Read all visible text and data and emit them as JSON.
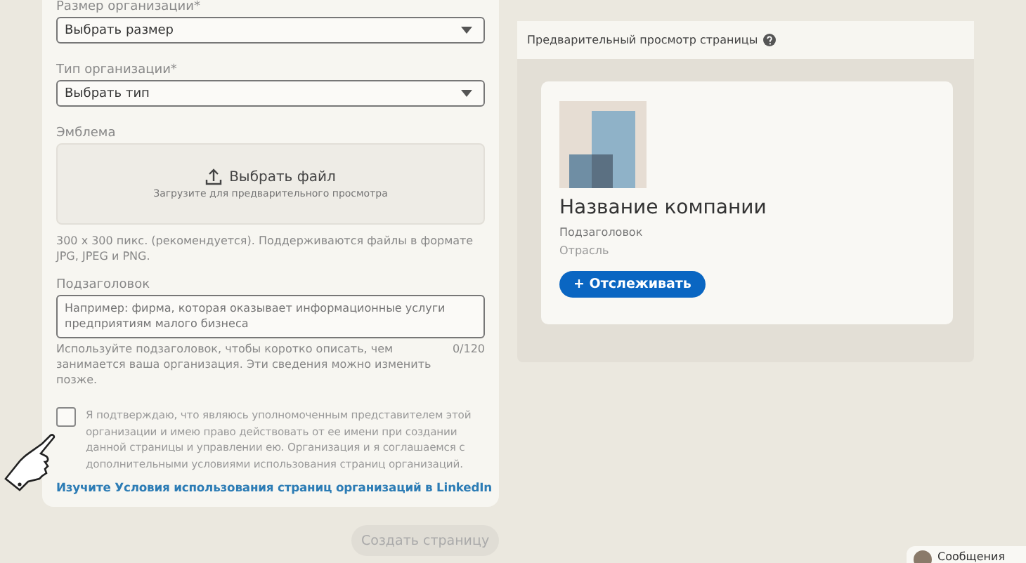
{
  "form": {
    "size_field": {
      "label": "Размер организации*",
      "value": "Выбрать размер"
    },
    "type_field": {
      "label": "Тип организации*",
      "value": "Выбрать тип"
    },
    "logo": {
      "label": "Эмблема",
      "button": "Выбрать файл",
      "caption": "Загрузите для предварительного просмотра",
      "hint": "300 x 300 пикс. (рекомендуется). Поддерживаются файлы в формате JPG, JPEG и PNG."
    },
    "tagline": {
      "label": "Подзаголовок",
      "placeholder": "Например: фирма, которая оказывает информационные услуги предприятиям малого бизнеса",
      "help": "Используйте подзаголовок, чтобы коротко описать, чем занимается ваша организация. Эти сведения можно изменить позже.",
      "counter": "0/120"
    },
    "consent": {
      "checked": false,
      "text": "Я подтверждаю, что являюсь уполномоченным представителем этой организации и имею право действовать от ее имени при создании данной страницы и управлении ею. Организация и я соглашаемся с дополнительными условиями использования страниц организаций."
    },
    "terms_link": "Изучите Условия использования страниц организаций в LinkedIn"
  },
  "create_button": {
    "label": "Создать страницу",
    "disabled": true
  },
  "preview": {
    "title": "Предварительный просмотр страницы",
    "company_name": "Название компании",
    "tagline": "Подзаголовок",
    "industry": "Отрасль",
    "follow_button": "+ Отслеживать"
  },
  "messaging": {
    "label": "Сообщения"
  }
}
